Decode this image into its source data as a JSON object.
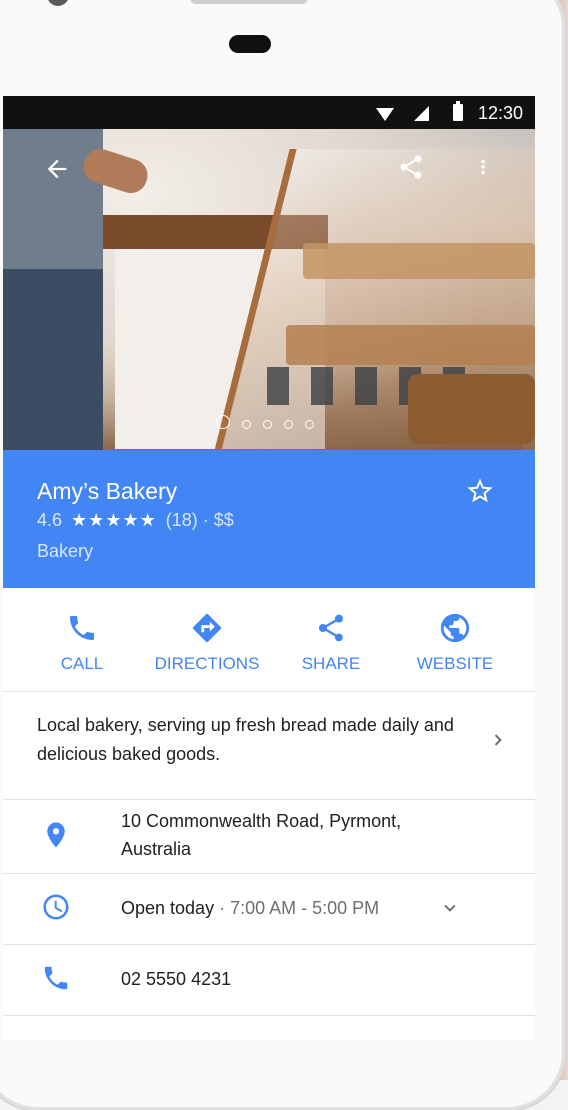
{
  "status_bar": {
    "time": "12:30"
  },
  "place": {
    "name": "Amy’s Bakery",
    "rating": "4.6",
    "stars": "★★★★★",
    "review_count": "(18)",
    "separator": "·",
    "price": "$$",
    "category": "Bakery"
  },
  "hero": {
    "photo_count": 5,
    "active_photo": 1
  },
  "actions": [
    {
      "label": "CALL",
      "icon": "phone-icon"
    },
    {
      "label": "DIRECTIONS",
      "icon": "directions-icon"
    },
    {
      "label": "SHARE",
      "icon": "share-icon"
    },
    {
      "label": "WEBSITE",
      "icon": "globe-icon"
    }
  ],
  "description": "Local bakery, serving up fresh bread made daily and delicious baked goods.",
  "details": {
    "address": "10 Commonwealth Road, Pyrmont, Australia",
    "hours_status": "Open today",
    "hours_separator": "·",
    "hours_range": "7:00 AM - 5:00 PM",
    "phone": "02 5550 4231"
  },
  "colors": {
    "accent": "#4285f4",
    "header_text": "#ffffff"
  }
}
